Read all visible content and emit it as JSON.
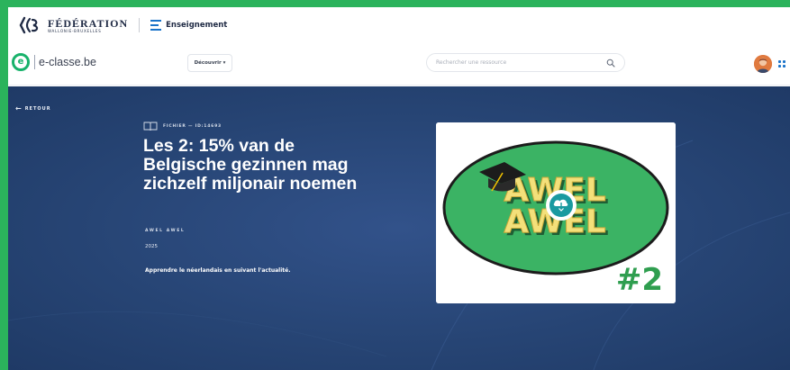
{
  "brand": {
    "federation_title": "FÉDÉRATION",
    "federation_subtitle": "WALLONIE-BRUXELLES",
    "section": "Enseignement",
    "section_icon": "lines-icon"
  },
  "nav": {
    "site_name": "e-classe.be",
    "logo_letter": "e",
    "discover_label": "Découvrir ▾",
    "search_placeholder": "Rechercher une ressource",
    "search_icon": "search-icon",
    "apps_icon": "grid-icon"
  },
  "resource": {
    "back_label": "RETOUR",
    "type_label": "FICHIER — ID:14693",
    "title": "Les 2: 15% van de Belgische gezinnen mag zichzelf miljonair noemen",
    "author": "AWEL AWEL",
    "year": "2025",
    "description": "Apprendre le néerlandais en suivant l'actualité.",
    "thumbnail": {
      "word_top": "AWEL",
      "word_bottom": "AWEL",
      "episode": "#2",
      "icon": "download-icon"
    }
  },
  "colors": {
    "page_border": "#2bb35c",
    "hero_bg": "#274575",
    "accent_green": "#18b26b",
    "accent_blue": "#1a73c9",
    "thumb_green": "#3bb364",
    "thumb_text": "#f3e07a",
    "episode_green": "#2f9e4f"
  }
}
